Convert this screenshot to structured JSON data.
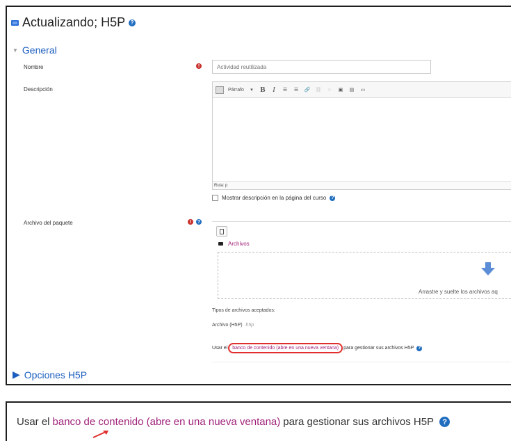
{
  "header": {
    "title": "Actualizando; H5P"
  },
  "sections": {
    "general": "General",
    "options": "Opciones H5P"
  },
  "fields": {
    "name_label": "Nombre",
    "name_value": "Actividad reutilizada",
    "description_label": "Descripción",
    "toolbar": {
      "paragraph": "Párrafo",
      "bold": "B",
      "italic": "I"
    },
    "path": "Ruta: p",
    "show_description": "Mostrar descripción en la página del curso",
    "package_label": "Archivo del paquete",
    "files_crumb": "Archivos",
    "drop_text": "Arrastre y suelte los archivos aq",
    "accepted_types_title": "Tipos de archivos aceptados:",
    "accepted_type": "Archivo (H5P)",
    "accepted_ext": ".h5p",
    "bank_prefix": "Usar el",
    "bank_link": "banco de contenido (abre en una nueva ventana)",
    "bank_suffix": "para gestionar sus archivos H5P"
  },
  "zoom": {
    "prefix": "Usar el",
    "link": "banco de contenido (abre en una nueva ventana)",
    "suffix": "para gestionar sus archivos H5P"
  },
  "colors": {
    "link": "#a0237a",
    "accent": "#1d5fbf",
    "highlight": "#e12e2e",
    "required": "#c9302c"
  }
}
